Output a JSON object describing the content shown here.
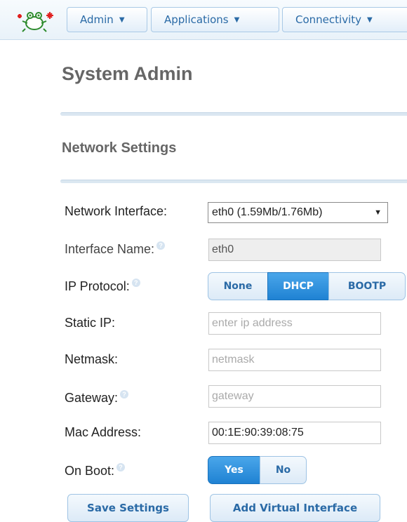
{
  "nav": {
    "admin": "Admin",
    "applications": "Applications",
    "connectivity": "Connectivity"
  },
  "page": {
    "title": "System Admin",
    "section": "Network Settings"
  },
  "form": {
    "network_interface": {
      "label": "Network Interface:",
      "value": "eth0 (1.59Mb/1.76Mb)"
    },
    "interface_name": {
      "label": "Interface Name:",
      "value": "eth0"
    },
    "ip_protocol": {
      "label": "IP Protocol:",
      "options": [
        "None",
        "DHCP",
        "BOOTP"
      ],
      "selected": "DHCP"
    },
    "static_ip": {
      "label": "Static IP:",
      "value": "",
      "placeholder": "enter ip address"
    },
    "netmask": {
      "label": "Netmask:",
      "value": "",
      "placeholder": "netmask"
    },
    "gateway": {
      "label": "Gateway:",
      "value": "",
      "placeholder": "gateway"
    },
    "mac_address": {
      "label": "Mac Address:",
      "value": "00:1E:90:39:08:75"
    },
    "on_boot": {
      "label": "On Boot:",
      "options": [
        "Yes",
        "No"
      ],
      "selected": "Yes"
    }
  },
  "actions": {
    "save": "Save Settings",
    "add_virtual": "Add Virtual Interface"
  },
  "icons": {
    "logo": "frog-logo-icon",
    "help": "help-icon",
    "caret": "chevron-down-icon"
  },
  "colors": {
    "accent": "#1f82d3",
    "link": "#2a6aa6",
    "heading": "#666666"
  }
}
